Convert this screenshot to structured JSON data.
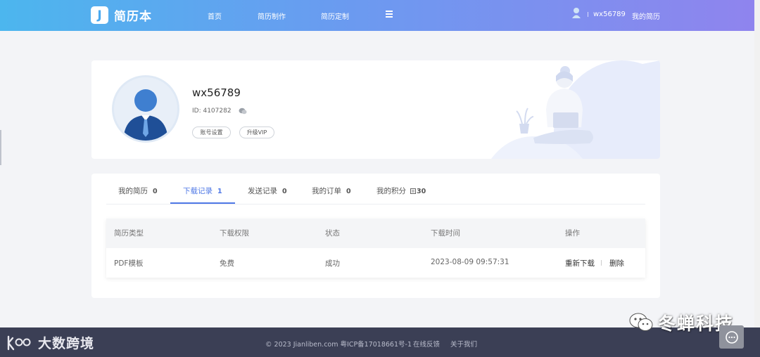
{
  "header": {
    "logo_letter": "J",
    "logo_text": "简历本",
    "nav": [
      "首页",
      "简历制作",
      "简历定制"
    ],
    "menu_icon": "hamburger-menu-icon",
    "username": "wx56789",
    "my_resume": "我的简历"
  },
  "profile": {
    "username": "wx56789",
    "id_text": "ID: 4107282",
    "buttons": [
      "账号设置",
      "升级VIP"
    ]
  },
  "tabs": [
    {
      "label": "我的简历",
      "count": "0"
    },
    {
      "label": "下载记录",
      "count": "1",
      "active": true
    },
    {
      "label": "发送记录",
      "count": "0"
    },
    {
      "label": "我的订单",
      "count": "0"
    },
    {
      "label": "我的积分",
      "count": "30",
      "icon": "points-icon"
    }
  ],
  "table": {
    "headers": [
      "简历类型",
      "下载权限",
      "状态",
      "下载时间",
      "操作"
    ],
    "rows": [
      {
        "type": "PDF模板",
        "permission": "免费",
        "status": "成功",
        "time": "2023-08-09 09:57:31",
        "actions": [
          "重新下载",
          "删除"
        ]
      }
    ]
  },
  "footer": {
    "copyright": "© 2023 Jianliben.com 粤ICP备17018661号-1",
    "links": [
      "在线反馈",
      "关于我们"
    ]
  },
  "watermarks": {
    "left": "大数跨境",
    "right": "冬蝉科技"
  },
  "colors": {
    "accent": "#4f78e6",
    "header_start": "#4cb6ee",
    "header_end": "#8f84ee",
    "footer_bg": "#3b3f55"
  }
}
